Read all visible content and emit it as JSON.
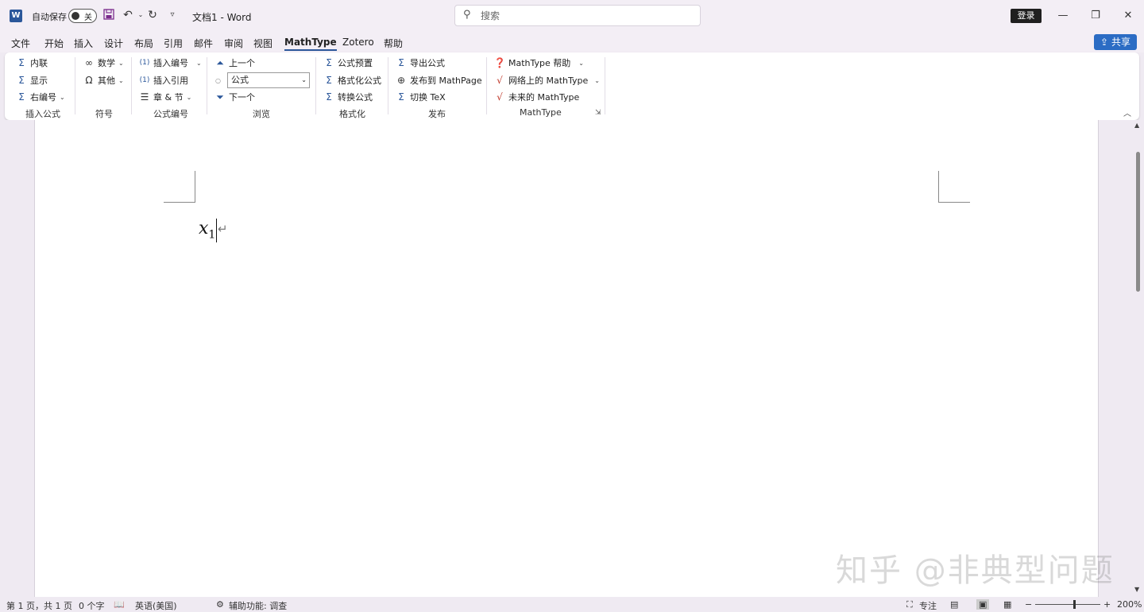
{
  "titlebar": {
    "app_icon": "W",
    "autosave_label": "自动保存",
    "autosave_state": "关",
    "doc_title": "文档1  -  Word",
    "search_placeholder": "搜索",
    "login_label": "登录",
    "icons": {
      "save": "save-icon",
      "undo": "undo-icon",
      "redo": "redo-icon",
      "customize": "customize-quick-access-icon"
    }
  },
  "menu": {
    "items": [
      "文件",
      "开始",
      "插入",
      "设计",
      "布局",
      "引用",
      "邮件",
      "审阅",
      "视图",
      "MathType",
      "Zotero",
      "帮助"
    ],
    "active": "MathType",
    "share_label": "共享"
  },
  "ribbon": {
    "insert_equation": {
      "label": "插入公式",
      "inline": "内联",
      "display": "显示",
      "right_numbered": "右编号"
    },
    "symbols": {
      "label": "符号",
      "math": "数学",
      "other": "其他"
    },
    "equation_numbers": {
      "label": "公式编号",
      "insert_number": "插入编号",
      "insert_reference": "插入引用",
      "chapter_section": "章 & 节"
    },
    "browse": {
      "label": "浏览",
      "previous": "上一个",
      "style_value": "公式",
      "next": "下一个"
    },
    "format": {
      "label": "格式化",
      "presets": "公式预置",
      "format_equations": "格式化公式",
      "convert_equations": "转换公式"
    },
    "publish": {
      "label": "发布",
      "export": "导出公式",
      "publish_mathpage": "发布到 MathPage",
      "toggle_tex": "切换 TeX"
    },
    "mathtype": {
      "label": "MathType",
      "help": "MathType 帮助",
      "online": "网络上的 MathType",
      "future": "未来的 MathType"
    }
  },
  "document": {
    "equation_var": "x",
    "equation_sub": "1",
    "para_mark": "↵",
    "watermark": "知乎 @非典型问题"
  },
  "status": {
    "page": "第 1 页，共 1 页",
    "words": "0 个字",
    "language": "英语(美国)",
    "accessibility": "辅助功能: 调查",
    "focus": "专注",
    "zoom": "200%"
  },
  "colors": {
    "accent": "#2b579a",
    "share": "#2b6cc4",
    "titlebar_bg": "#f3eef5"
  }
}
